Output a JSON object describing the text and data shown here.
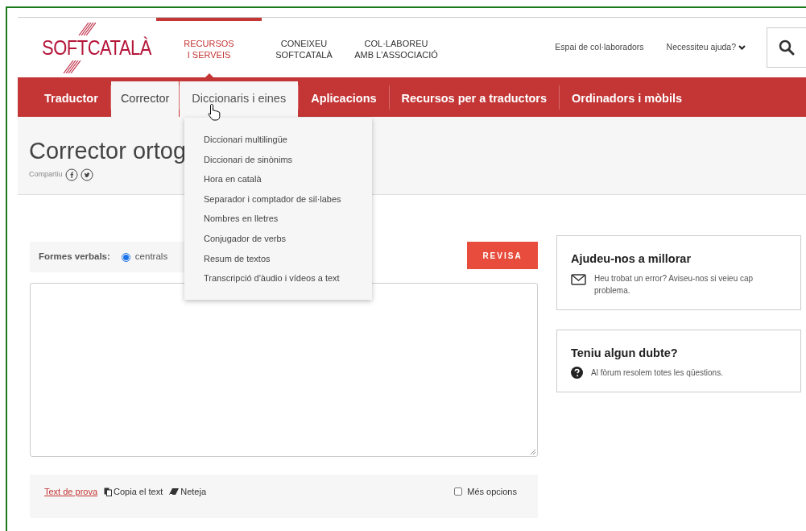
{
  "logo": {
    "text": "SOFTCATALÀ"
  },
  "top_nav": [
    {
      "lines": [
        "RECURSOS",
        "I SERVEIS"
      ],
      "selected": true
    },
    {
      "lines": [
        "CONEIXEU",
        "SOFTCATALÀ"
      ],
      "selected": false
    },
    {
      "lines": [
        "COL·LABOREU",
        "AMB L'ASSOCIACIÓ"
      ],
      "selected": false
    }
  ],
  "utility_links": [
    {
      "label": "Espai de col·laboradors",
      "kind": "link"
    },
    {
      "label": "Necessiteu ajuda?",
      "kind": "dropdown"
    }
  ],
  "main_nav": [
    {
      "label": "Traductor",
      "selected": false,
      "expanded": false
    },
    {
      "label": "Corrector",
      "selected": true,
      "expanded": false
    },
    {
      "label": "Diccionaris i eines",
      "selected": false,
      "expanded": true
    },
    {
      "label": "Aplicacions",
      "selected": false,
      "expanded": false
    },
    {
      "label": "Recursos per a traductors",
      "selected": false,
      "expanded": false
    },
    {
      "label": "Ordinadors i mòbils",
      "selected": false,
      "expanded": false
    }
  ],
  "dropdown": [
    "Diccionari multilingüe",
    "Diccionari de sinònims",
    "Hora en català",
    "Separador i comptador de sil·labes",
    "Nombres en lletres",
    "Conjugador de verbs",
    "Resum de textos",
    "Transcripció d'àudio i vídeos a text"
  ],
  "page_title": "Corrector ortog",
  "share": {
    "label": "Compartiu"
  },
  "form": {
    "label": "Formes verbals:",
    "radio": {
      "label": "centrals",
      "selected": true
    },
    "button": "REVISA"
  },
  "toolbar": [
    {
      "label": "Text de prova",
      "kind": "link"
    },
    {
      "label": "Copia el text",
      "kind": "copy"
    },
    {
      "label": "Neteja",
      "kind": "erase"
    }
  ],
  "more_options": {
    "label": "Més opcions",
    "checked": false
  },
  "cards": [
    {
      "title": "Ajudeu-nos a millorar",
      "text": "Heu trobat un error? Aviseu-nos si veieu cap problema.",
      "kind": "mail"
    },
    {
      "title": "Teniu algun dubte?",
      "text": "Al fòrum resolem totes les qüestions.",
      "kind": "help"
    }
  ]
}
